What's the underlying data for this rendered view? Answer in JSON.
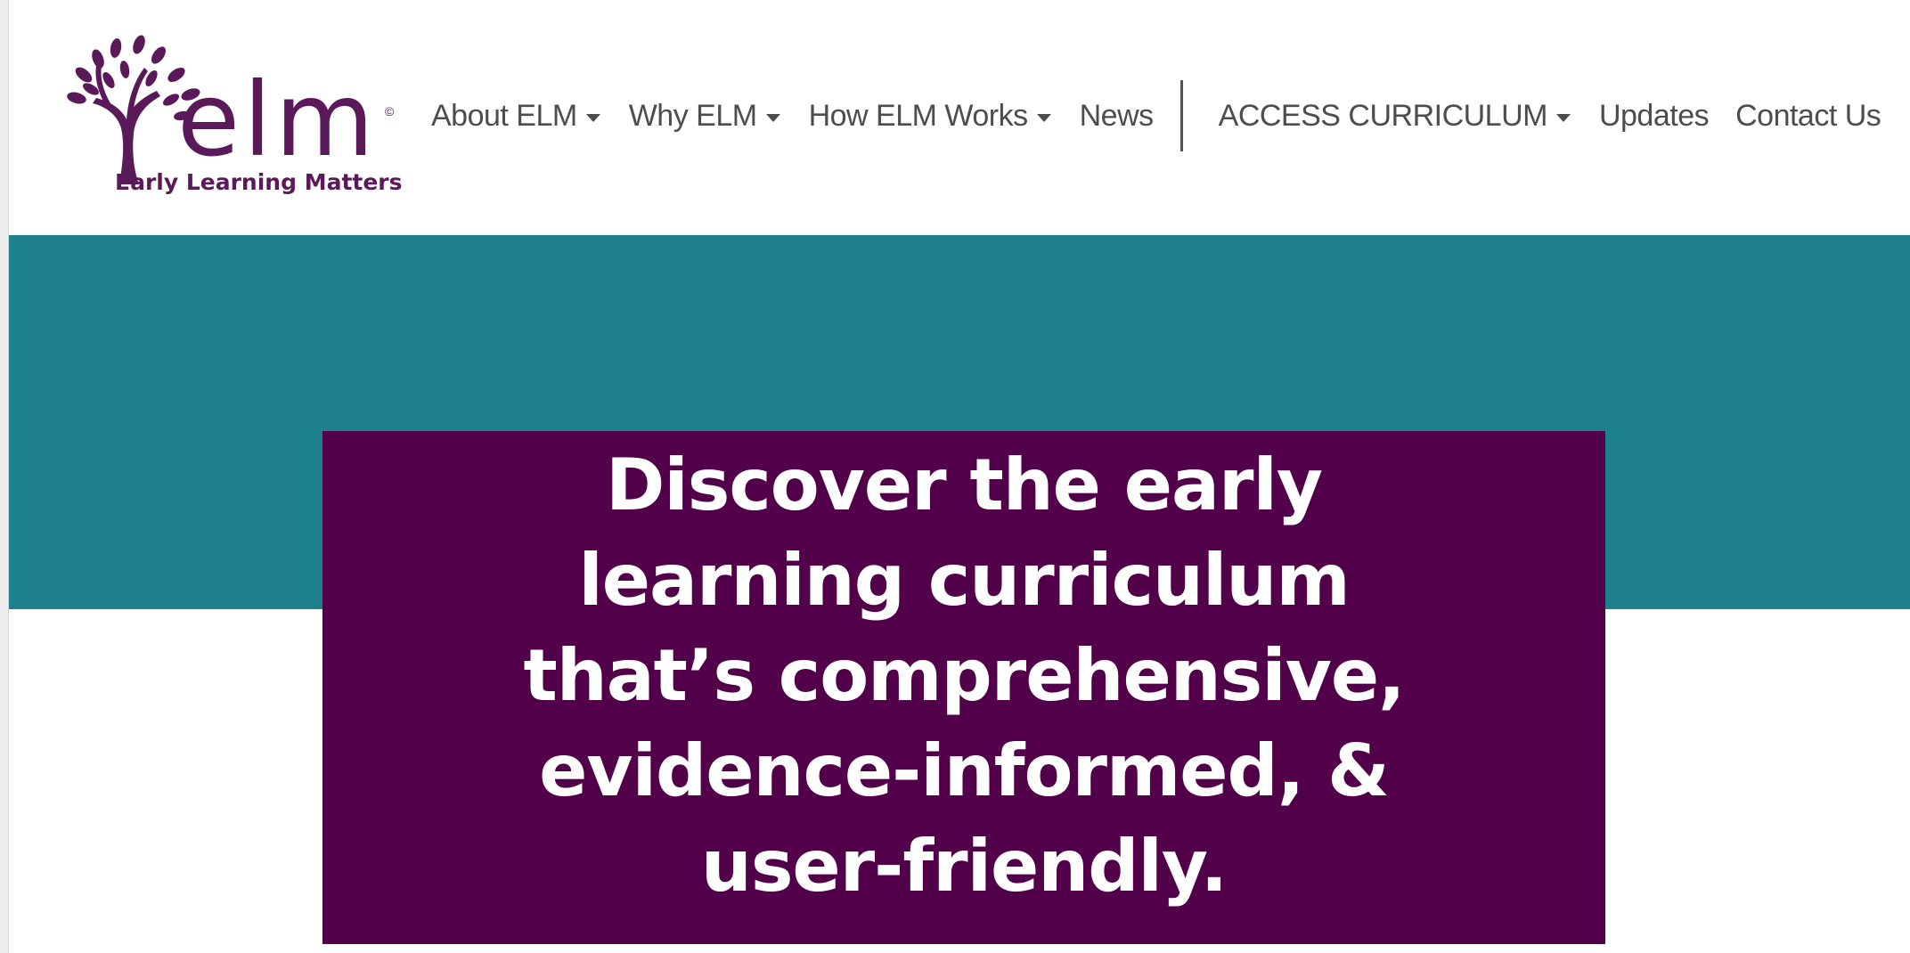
{
  "colors": {
    "brand": "#5a1a5a",
    "teal": "#1d808c",
    "plum": "#52004a",
    "nav_text": "#4d4d4d"
  },
  "logo": {
    "wordmark": "elm",
    "copyright": "©",
    "tagline": "Early Learning Matters",
    "icon": "tree-icon"
  },
  "nav": {
    "items": [
      {
        "label": "About ELM",
        "has_dropdown": true
      },
      {
        "label": "Why ELM",
        "has_dropdown": true
      },
      {
        "label": "How ELM Works",
        "has_dropdown": true
      },
      {
        "label": "News",
        "has_dropdown": false
      },
      {
        "label": "ACCESS CURRICULUM",
        "has_dropdown": true
      },
      {
        "label": "Updates",
        "has_dropdown": false
      },
      {
        "label": "Contact Us",
        "has_dropdown": false
      }
    ]
  },
  "hero": {
    "heading": "Discover the early learning curriculum that’s comprehensive, evidence-informed, & user-friendly."
  }
}
